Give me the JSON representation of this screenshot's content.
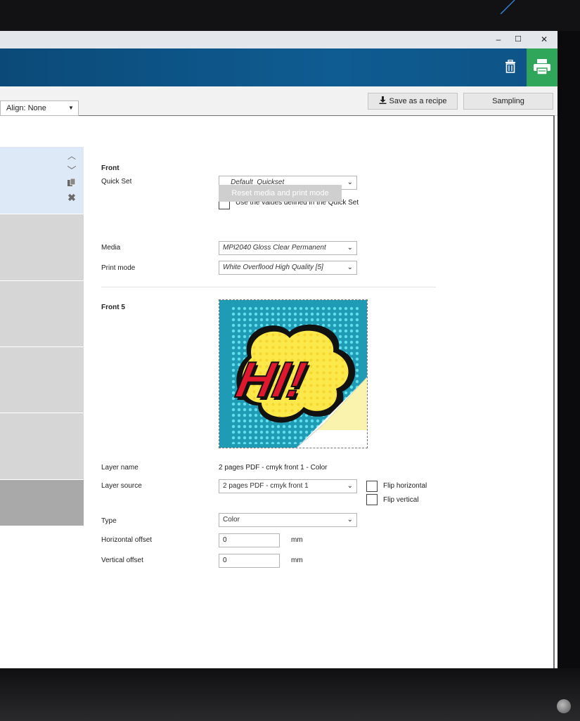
{
  "window_controls": {
    "minimize": "–",
    "maximize": "☐",
    "close": "✕"
  },
  "header": {
    "delete_icon": "trash-icon",
    "print_icon": "printer-icon"
  },
  "toolbar": {
    "save_recipe_label": "Save as a recipe",
    "save_icon": "download-icon",
    "sampling_label": "Sampling"
  },
  "left_panel": {
    "align_value": "Align: None"
  },
  "front": {
    "section_title": "Front",
    "quick_set_label": "Quick Set",
    "quick_set_value": "__Default_Quickset__",
    "use_quickset_label": "Use the values defined in the Quick Set",
    "reset_label": "Reset media and print mode",
    "media_label": "Media",
    "media_value": "MPI2040 Gloss Clear Permanent",
    "print_mode_label": "Print mode",
    "print_mode_value": "White Overflood High Quality [5]"
  },
  "layer": {
    "section_title": "Front 5",
    "preview_text": "HI!",
    "layer_name_label": "Layer name",
    "layer_name_value": "2 pages PDF - cmyk front 1 - Color",
    "layer_source_label": "Layer source",
    "layer_source_value": "2 pages PDF - cmyk front 1",
    "flip_horizontal_label": "Flip horizontal",
    "flip_vertical_label": "Flip vertical",
    "type_label": "Type",
    "type_value": "Color",
    "h_offset_label": "Horizontal offset",
    "h_offset_value": "0",
    "v_offset_label": "Vertical offset",
    "v_offset_value": "0",
    "unit": "mm"
  },
  "colors": {
    "header_blue": "#0f5c92",
    "print_green": "#2fa65a",
    "selected_item": "#dde9f7",
    "item_gray": "#d6d6d6"
  }
}
